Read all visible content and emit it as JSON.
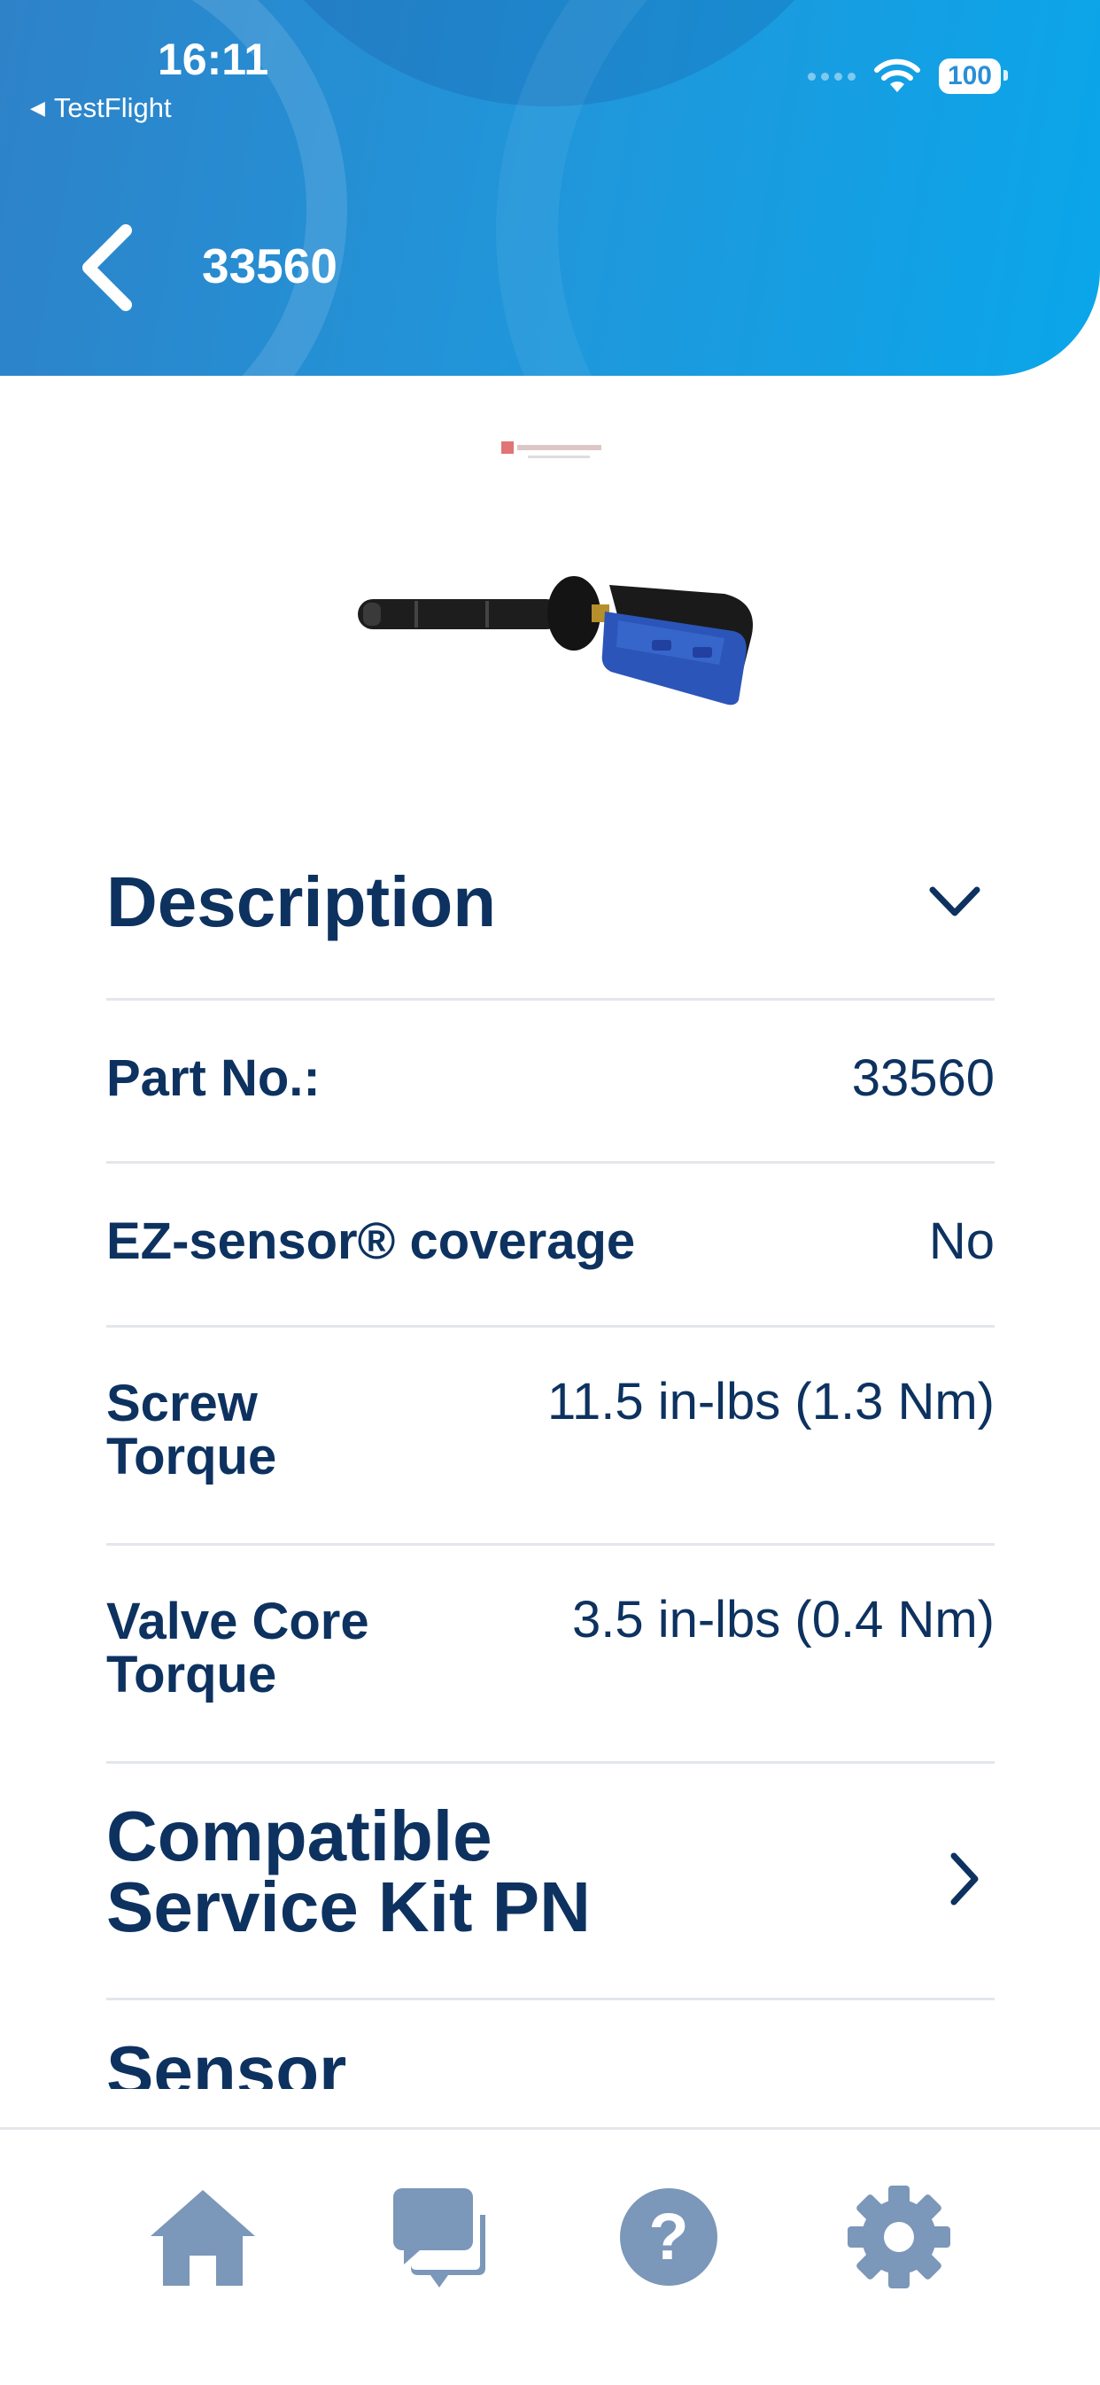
{
  "status_bar": {
    "time": "16:11",
    "back_app": "TestFlight",
    "battery": "100"
  },
  "nav": {
    "title": "33560",
    "back_icon": "chevron-left-icon"
  },
  "product": {
    "brand_logo": "Schrader"
  },
  "description": {
    "title": "Description"
  },
  "specs": [
    {
      "label": "Part No.:",
      "value": "33560"
    },
    {
      "label": "EZ-sensor® coverage",
      "value": "No"
    },
    {
      "label_line1": "Screw",
      "label_line2": "Torque",
      "value": "11.5 in-lbs (1.3 Nm)"
    },
    {
      "label_line1": "Valve Core",
      "label_line2": "Torque",
      "value": "3.5 in-lbs (0.4 Nm)"
    }
  ],
  "compatible_kit": {
    "line1": "Compatible",
    "line2": "Service Kit PN"
  },
  "sensor_section": {
    "title": "Sensor"
  },
  "tabbar": {
    "items": [
      {
        "icon": "home-icon"
      },
      {
        "icon": "chat-icon"
      },
      {
        "icon": "help-icon"
      },
      {
        "icon": "gear-icon"
      }
    ]
  },
  "colors": {
    "header_blue": "#1f98dc",
    "text_navy": "#0d3260",
    "tab_icon": "#7b97b9",
    "divider": "#e3e6ea"
  }
}
